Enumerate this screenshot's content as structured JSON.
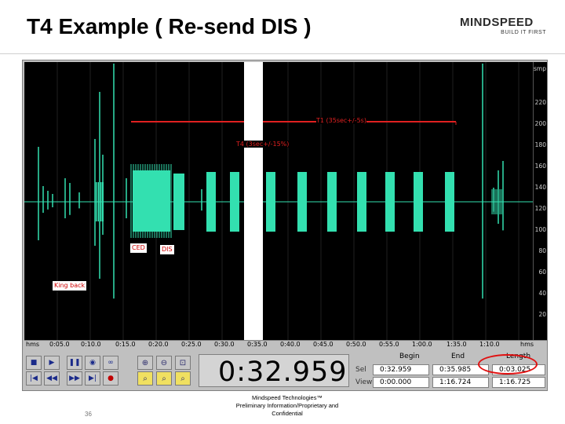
{
  "slide": {
    "title": "T4 Example ( Re-send DIS )",
    "page_number": "36",
    "footer_line1": "Mindspeed Technologies™",
    "footer_line2": "Preliminary Information/Proprietary and",
    "footer_line3": "Confidential"
  },
  "logo": {
    "name": "MINDSPEED",
    "tagline": "BUILD IT FIRST"
  },
  "waveform": {
    "amp_unit": "smp",
    "amp_ticks": [
      "220",
      "200",
      "180",
      "160",
      "140",
      "120",
      "100",
      "80",
      "60",
      "40",
      "20"
    ],
    "t1_label": "T1 (35sec+/-5s)",
    "t4_label": "T4 (3sec+/-15%)",
    "ced_label": "CED",
    "dis_label": "DIS",
    "king_back_label": "King back",
    "colors": {
      "waveform": "#33e0b0",
      "background": "#000000",
      "marker": "#e02020",
      "selection": "#ffffff"
    }
  },
  "time_ruler": {
    "labels": [
      "hms",
      "0:05.0",
      "0:10.0",
      "0:15.0",
      "0:20.0",
      "0:25.0",
      "0:30.0",
      "0:35.0",
      "0:40.0",
      "0:45.0",
      "0:50.0",
      "0:55.0",
      "1:00.0",
      "1:35.0",
      "1:10.0",
      "hms"
    ]
  },
  "transport": {
    "stop_icon": "stop-icon",
    "play_icon": "play-icon",
    "pause_icon": "pause-icon",
    "play_to_end_icon": "play-to-end-icon",
    "loop_icon": "loop-icon",
    "go_start_icon": "go-to-start-icon",
    "rewind_icon": "rewind-icon",
    "forward_icon": "fast-forward-icon",
    "go_end_icon": "go-to-end-icon",
    "record_icon": "record-icon"
  },
  "timer": {
    "value": "0:32.959"
  },
  "time_table": {
    "header_begin": "Begin",
    "header_end": "End",
    "header_length": "Length",
    "sel_label": "Sel",
    "view_label": "View",
    "sel_begin": "0:32.959",
    "sel_end": "0:35.985",
    "sel_length": "0:03.025",
    "view_begin": "0:00.000",
    "view_end": "1:16.724",
    "view_length": "1:16.725"
  }
}
